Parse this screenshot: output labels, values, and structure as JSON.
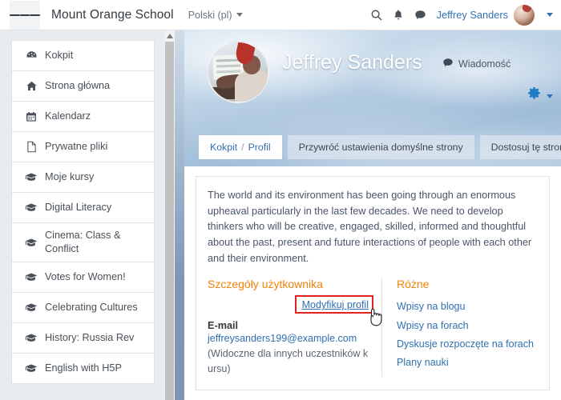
{
  "navbar": {
    "menu_icon": "hamburger-icon",
    "brand": "Mount Orange School",
    "language": "Polski (pl)",
    "icons": [
      "search-icon",
      "bell-icon",
      "message-icon"
    ],
    "user_name": "Jeffrey Sanders",
    "avatar": "user-avatar"
  },
  "sidebar": {
    "items": [
      {
        "label": "Kokpit",
        "icon": "dashboard-icon"
      },
      {
        "label": "Strona główna",
        "icon": "home-icon"
      },
      {
        "label": "Kalendarz",
        "icon": "calendar-icon"
      },
      {
        "label": "Prywatne pliki",
        "icon": "file-icon"
      },
      {
        "label": "Moje kursy",
        "icon": "graduation-cap-icon"
      },
      {
        "label": "Digital Literacy",
        "icon": "graduation-cap-icon"
      },
      {
        "label": "Cinema: Class & Conflict",
        "icon": "graduation-cap-icon"
      },
      {
        "label": "Votes for Women!",
        "icon": "graduation-cap-icon"
      },
      {
        "label": "Celebrating Cultures",
        "icon": "graduation-cap-icon"
      },
      {
        "label": "History: Russia Rev",
        "icon": "graduation-cap-icon"
      },
      {
        "label": "English with H5P",
        "icon": "graduation-cap-icon"
      }
    ]
  },
  "profile": {
    "name": "Jeffrey Sanders",
    "message_label": "Wiadomość",
    "settings_icon": "gear-icon",
    "tabs": {
      "breadcrumb_first": "Kokpit",
      "breadcrumb_sep": "/",
      "breadcrumb_second": "Profil",
      "reset": "Przywróć ustawienia domyślne strony",
      "customize": "Dostosuj tę stronę"
    }
  },
  "main": {
    "intro": "The world and its environment has been going through an enormous upheaval particularly in the last few decades. We need to develop thinkers who will be creative, engaged, skilled, informed and thoughtful about the past, present and future interactions of people with each other and their environment.",
    "user_details": {
      "heading": "Szczegóły użytkownika",
      "edit_link": "Modyfikuj profil",
      "email_label": "E-mail",
      "email_value": "jeffreysanders199@example.com",
      "email_note": " (Widoczne dla innych uczestników kursu)"
    },
    "misc": {
      "heading": "Różne",
      "links": [
        "Wpisy na blogu",
        "Wpisy na forach",
        "Dyskusje rozpoczęte na forach",
        "Plany nauki"
      ]
    }
  },
  "colors": {
    "link": "#2f6fb0",
    "heading_orange": "#f0820a",
    "highlight_red": "#e02424",
    "sidebar_bg": "#e9ecef"
  }
}
